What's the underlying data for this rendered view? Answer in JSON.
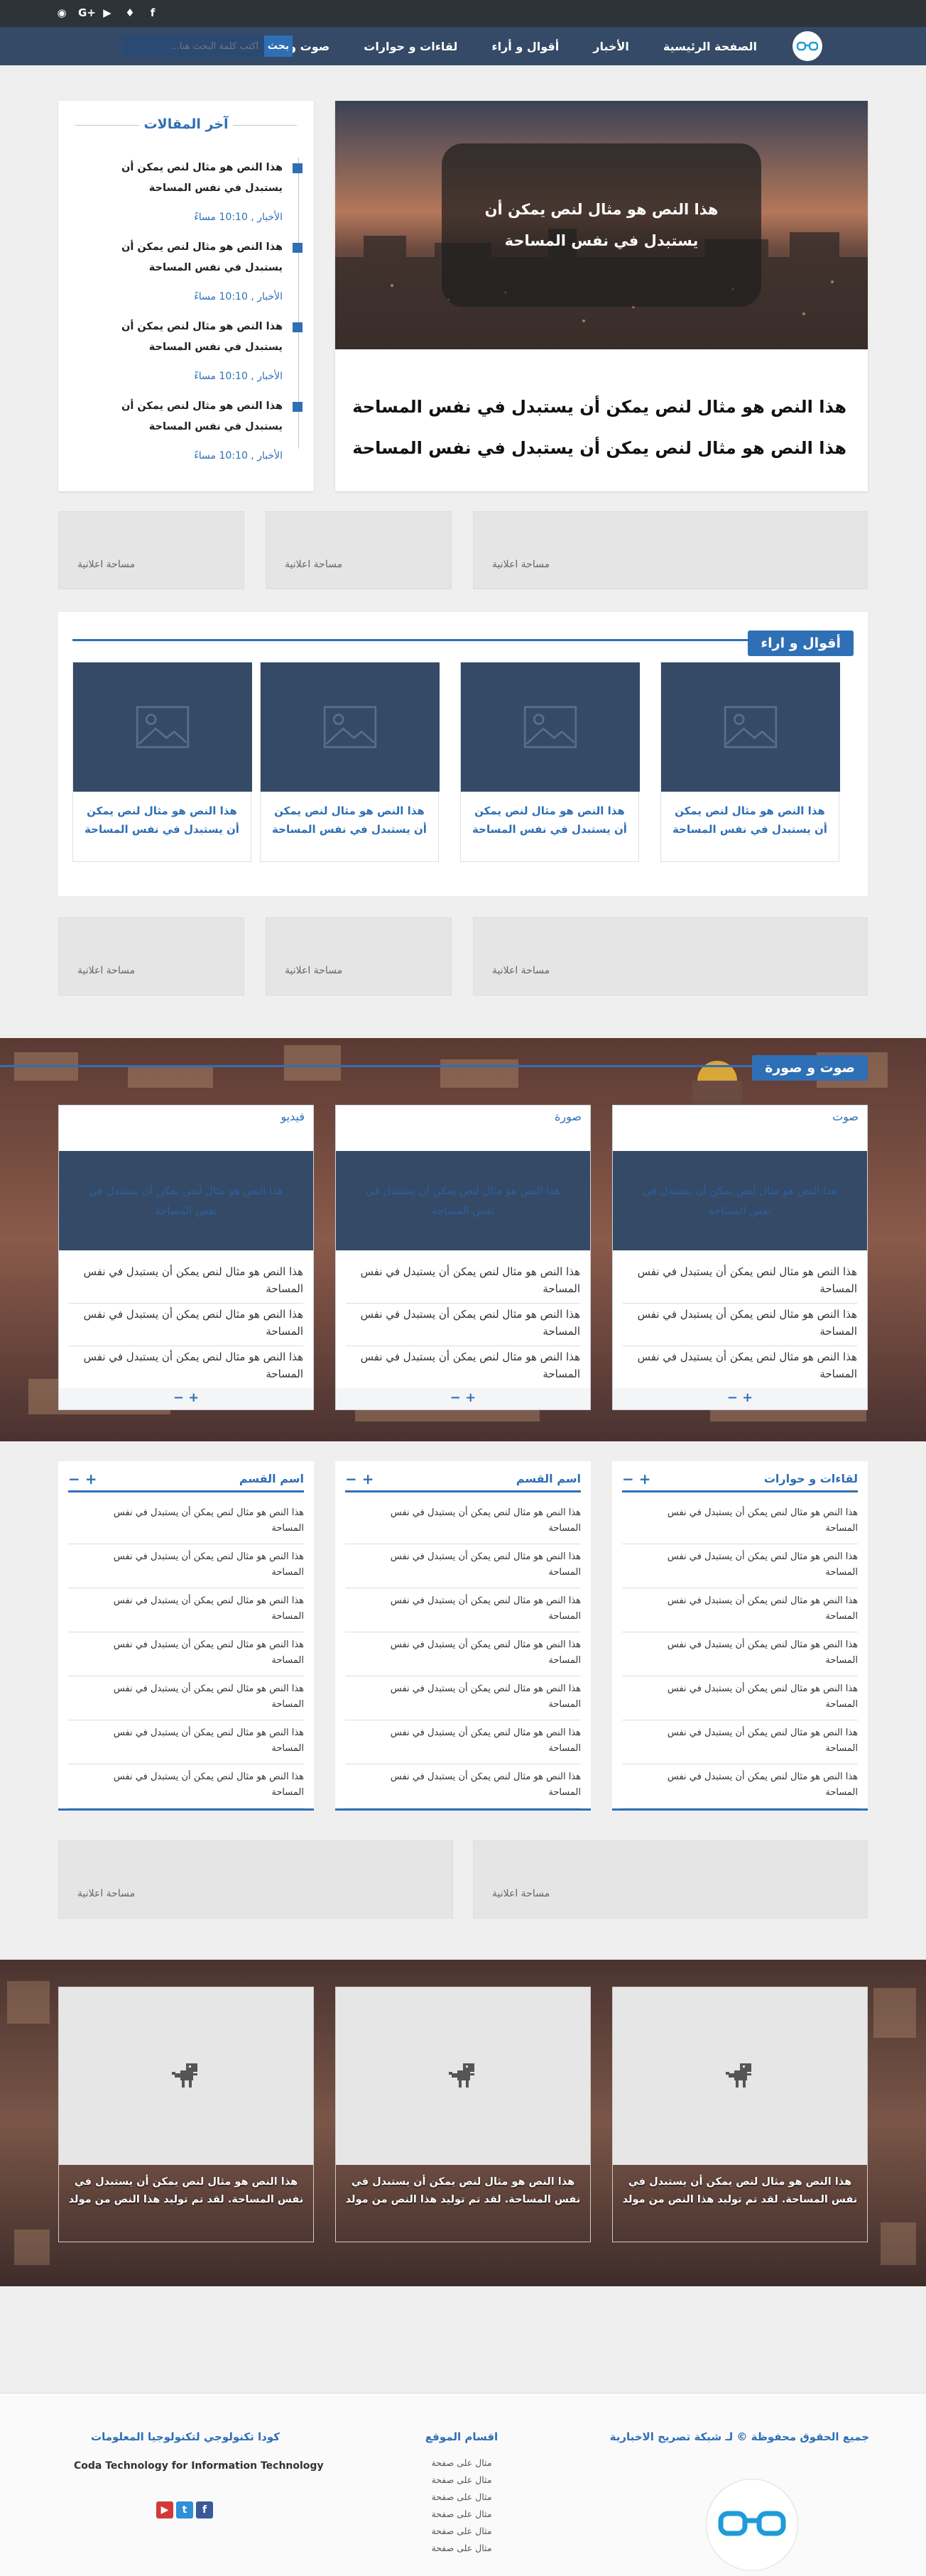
{
  "topbar": {
    "social_icons": [
      {
        "name": "rss-icon",
        "glyph": "◉"
      },
      {
        "name": "google-plus-icon",
        "glyph": "G+"
      },
      {
        "name": "youtube-icon",
        "glyph": "▶"
      },
      {
        "name": "twitter-icon",
        "glyph": "♦"
      },
      {
        "name": "facebook-icon",
        "glyph": "f"
      }
    ]
  },
  "nav": {
    "items": [
      "الصفحة الرئيسية",
      "الأخبار",
      "أقوال و أراء",
      "لقاءات و حوارات",
      "صوت و صورة"
    ],
    "search_placeholder": "أكتب كلمة البحث هنا...",
    "search_button": "بحث"
  },
  "latest": {
    "title": "آخر المقالات",
    "items": [
      {
        "title": "هذا النص هو مثال لنص يمكن أن يستبدل في نفس المساحة",
        "meta": "الأخبار , 10:10 مساءً"
      },
      {
        "title": "هذا النص هو مثال لنص يمكن أن يستبدل في نفس المساحة",
        "meta": "الأخبار , 10:10 مساءً"
      },
      {
        "title": "هذا النص هو مثال لنص يمكن أن يستبدل في نفس المساحة",
        "meta": "الأخبار , 10:10 مساءً"
      },
      {
        "title": "هذا النص هو مثال لنص يمكن أن يستبدل في نفس المساحة",
        "meta": "الأخبار , 10:10 مساءً"
      }
    ]
  },
  "featured": {
    "caption": "هذا النص هو مثال لنص يمكن أن يستبدل في نفس المساحة",
    "title": "هذا النص هو مثال لنص يمكن أن يستبدل في نفس المساحة هذا النص هو مثال لنص يمكن أن يستبدل في نفس المساحة"
  },
  "ad_label": "مساحة اعلانية",
  "opinions": {
    "title": "أقوال و اراء",
    "cards": [
      "هذا النص هو مثال لنص يمكن أن يستبدل في نفس المساحة",
      "هذا النص هو مثال لنص يمكن أن يستبدل في نفس المساحة",
      "هذا النص هو مثال لنص يمكن أن يستبدل في نفس المساحة",
      "هذا النص هو مثال لنص يمكن أن يستبدل في نفس المساحة"
    ]
  },
  "media": {
    "title": "صوت و صورة",
    "video_text": "هذا النص هو مثال لنص يمكن أن يستبدل في نفس المساحة",
    "row_text": "هذا النص هو مثال لنص يمكن أن يستبدل في نفس المساحة",
    "footer": "+ −",
    "cards": [
      "صوت",
      "صورة",
      "فيديو"
    ]
  },
  "lists": {
    "item_text": "هذا النص هو مثال لنص يمكن أن يستبدل في نفس المساحة",
    "plus_minus": "+ −",
    "cards": [
      "لقاءات و حوارات",
      "اسم القسم",
      "اسم القسم"
    ]
  },
  "gallery": {
    "caption": "هذا النص هو مثال لنص يمكن أن يستبدل في نفس المساحة. لقد تم توليد هذا النص من مولد",
    "cards": 3
  },
  "footer": {
    "copyright": "جميع الحقوق محفوظة © لـ شبكة تصريح الاخبارية",
    "categories_title": "اقسام الموقع",
    "categories": [
      "مثال على صفحة",
      "مثال على صفحة",
      "مثال على صفحة",
      "مثال على صفحة",
      "مثال على صفحة",
      "مثال على صفحة"
    ],
    "company_ar": "كودا تكنولوجي لتكنولوجيا المعلومات",
    "company_en": "Coda Technology for Information Technology",
    "social": [
      {
        "name": "youtube-icon",
        "glyph": "▶",
        "color": "#d13a3a"
      },
      {
        "name": "twitter-icon",
        "glyph": "t",
        "color": "#2f8fd8"
      },
      {
        "name": "facebook-icon",
        "glyph": "f",
        "color": "#3b5998"
      }
    ]
  },
  "colors": {
    "accent": "#2f6fb5",
    "nav": "#344a66",
    "topbar": "#2e3338"
  }
}
